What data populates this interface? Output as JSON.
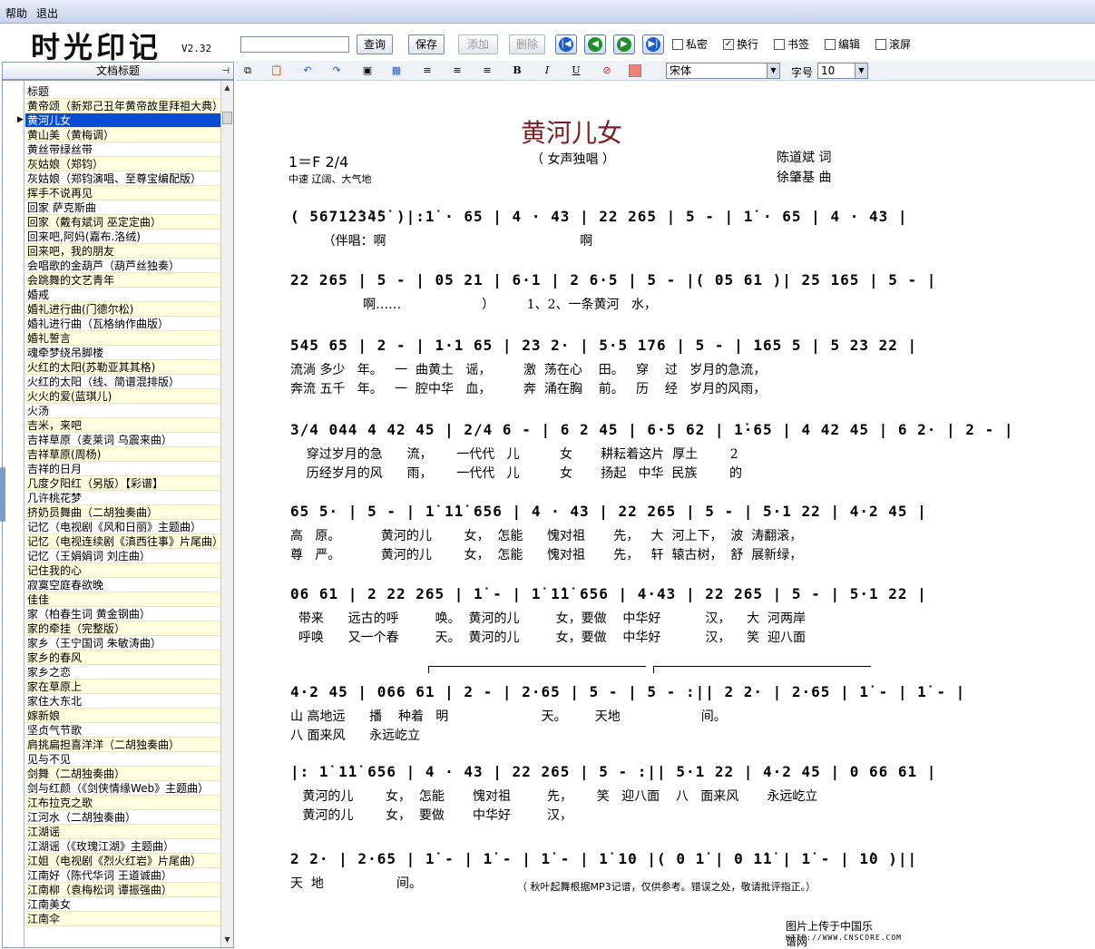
{
  "menu": {
    "help": "帮助",
    "exit": "退出"
  },
  "app": {
    "logo": "时光印记",
    "version": "V2.32"
  },
  "toolbar": {
    "search_value": "",
    "query_label": "查询",
    "save_label": "保存",
    "add_label": "添加",
    "delete_label": "删除",
    "checkboxes": [
      {
        "label": "私密",
        "checked": false
      },
      {
        "label": "换行",
        "checked": true
      },
      {
        "label": "书签",
        "checked": false
      },
      {
        "label": "编辑",
        "checked": false
      },
      {
        "label": "滚屏",
        "checked": false
      }
    ]
  },
  "format": {
    "font": "宋体",
    "size_label": "字号",
    "size": "10"
  },
  "sidebar": {
    "header": "文档标题",
    "items": [
      "标题",
      "黄帝颂（新郑己丑年黄帝故里拜祖大典）",
      "黄河儿女",
      "黄山美（黄梅调）",
      "黄丝带绿丝带",
      "灰姑娘（郑钧）",
      "灰姑娘（郑钧演唱、至尊宝编配版）",
      "挥手不说再见",
      "回家 萨克斯曲",
      "回家（戴有斌词 巫定定曲）",
      "回来吧,阿妈(嘉布.洛绒)",
      "回来吧，我的朋友",
      "会唱歌的金葫芦（葫芦丝独奏）",
      "会跳舞的文艺青年",
      "婚戒",
      "婚礼进行曲(门德尔松)",
      "婚礼进行曲（瓦格纳作曲版）",
      "婚礼誓言",
      "魂牵梦绕吊脚楼",
      "火红的太阳(苏勒亚其其格)",
      "火红的太阳（线、简谱混排版）",
      "火火的爱(蓝琪儿)",
      "火汤",
      "吉米，来吧",
      "吉祥草原（麦莱词 乌震来曲）",
      "吉祥草原(周杨)",
      "吉祥的日月",
      "几度夕阳红（另版）【彩谱】",
      "几许桃花梦",
      "挤奶员舞曲（二胡独奏曲）",
      "记忆（电视剧《风和日丽》主题曲）",
      "记忆（电视连续剧《滇西往事》片尾曲）",
      "记忆（王娟娟词 刘庄曲）",
      "记住我的心",
      "寂寞空庭春欲晚",
      "佳佳",
      "家（柏春生词 黄金钢曲）",
      "家的牵挂（完整版）",
      "家乡（王宁国词 朱敏涛曲）",
      "家乡的春风",
      "家乡之恋",
      "家在草原上",
      "家住大东北",
      "嫁新娘",
      "坚贞气节歌",
      "肩挑扁担喜洋洋（二胡独奏曲）",
      "见与不见",
      "剑舞（二胡独奏曲）",
      "剑与红颜（《剑侠情缘Web》主题曲）",
      "江布拉克之歌",
      "江河水（二胡独奏曲）",
      "江湖谣",
      "江湖谣（《玫瑰江湖》主题曲）",
      "江姐（电视剧《烈火红岩》片尾曲）",
      "江南好（陈代华词 王道诚曲）",
      "江南柳（袁梅松词 谭振强曲）",
      "江南美女",
      "江南伞"
    ]
  },
  "sheet": {
    "title": "黄河儿女",
    "subtitle": "（ 女声独唱 ）",
    "key": "1＝F 2/4",
    "tempo": "中速  辽阔、大气地",
    "lyricist": "陈道斌    词",
    "composer": "徐肇基    曲",
    "lines": [
      {
        "notes": "( 5671̇2̇3̇4̇5̇ )|:1̇ · 65 | 4 · 43 | 22 265 | 5 - | 1̇ · 65 | 4 · 43 |",
        "lyrics": [
          "        （伴唱：啊                                                啊"
        ]
      },
      {
        "notes": "22 265 | 5 - | 05 21 | 6·1 | 2 6·5 | 5 - |( 05 61 )| 25 165 | 5 - |",
        "lyrics": [
          "                  啊……                    ）        1、2、一条黄河   水，"
        ]
      },
      {
        "notes": "545 65 | 2 - | 1·1 65 | 23 2· | 5·5 176 | 5 - | 165 5 | 5 23 22 |",
        "lyrics": [
          "流淌 多少   年。   一  曲黄土   谣，        激  荡在心    田。   穿    过   岁月的急流，",
          "奔流 五千   年。   一  腔中华   血，        奔  涌在胸    前。   历    经   岁月的风雨，"
        ]
      },
      {
        "notes": "3/4 044 4 42 45 | 2/4 6 - | 6 2 45 | 6·5 62 | 1̇·65 | 4 42 45 | 6 2· | 2 - |",
        "lyrics": [
          "    穿过岁月的急      流，      一代代   儿          女       耕耘着这片  厚土        2̇",
          "    历经岁月的风      雨，      一代代   儿          女       扬起   中华  民族        的"
        ]
      },
      {
        "notes": "65 5· | 5 - | 1̇ 1̇1̇ 656 | 4 · 43 | 22 265 | 5 - | 5·1 22 | 4·2 45 |",
        "lyrics": [
          "高   原。          黄河的儿        女，  怎能      愧对祖       先，   大  河上下，  波  涛翻滚，",
          "尊   严。          黄河的儿        女，  怎能      愧对祖       先，   轩  辕古树，  舒  展新绿，"
        ]
      },
      {
        "notes": "06 61 | 2 22 265 | 1̇ - | 1̇ 1̇1̇ 656 | 4·43 | 22 265 | 5 - | 5·1 22 |",
        "lyrics": [
          "  带来      远古的呼         唤。  黄河的儿         女，要做    中华好           汉，    大  河两岸",
          "  呼唤      又一个春         天。  黄河的儿         女，要做    中华好           汉，    笑  迎八面"
        ]
      },
      {
        "notes": "4·2 45 | 066 61 | 2 - | 2·65 | 5 - | 5 - :|| 2 2· | 2·65 | 1̇ - | 1̇ - |",
        "lyrics": [
          "山 高地远      播    种着   明                       天。       天地                    间。",
          "八 面来风      永远屹立"
        ]
      },
      {
        "notes": "|: 1̇ 1̇1̇ 656 | 4 · 43 | 22 265 | 5 - :|| 5·1 22 | 4·2 45 | 0 66 61 |",
        "lyrics": [
          "   黄河的儿        女，  怎能       愧对祖         先，      笑   迎八面    八   面来风       永远屹立",
          "   黄河的儿        女，  要做       中华好         汉，"
        ]
      },
      {
        "notes": "2 2· | 2·65 | 1̇ - | 1̇ - | 1̇ - | 1̇ 10 |( 0 1̇ | 0 1̇1̇ | 1̇ - | 1̇0 )||",
        "lyrics": [
          "天  地                  间。"
        ]
      }
    ],
    "footnote": "（ 秋叶起舞根据MP3记谱，仅供参考。错误之处，敬请批评指正。）"
  },
  "watermark": {
    "text": "图片上传于中国乐谱网",
    "url": "HTTP://WWW.CNSCORE.COM"
  }
}
